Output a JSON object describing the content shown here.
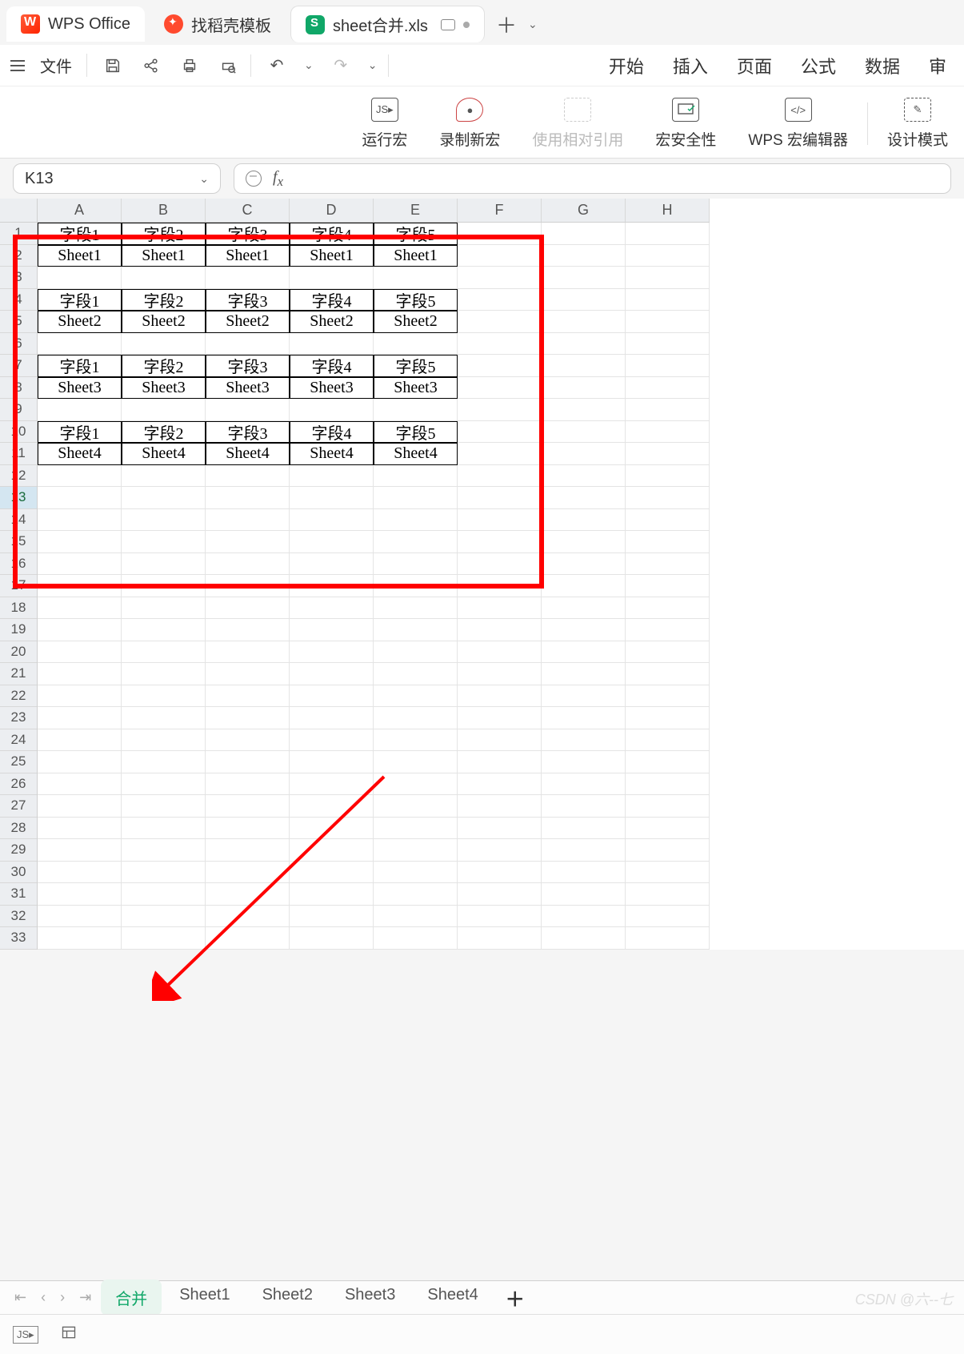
{
  "tabs": {
    "app": "WPS Office",
    "template": "找稻壳模板",
    "doc": "sheet合并.xls"
  },
  "file_label": "文件",
  "menu": {
    "start": "开始",
    "insert": "插入",
    "page": "页面",
    "formula": "公式",
    "data": "数据",
    "review": "审"
  },
  "ribbon": {
    "run_macro": "运行宏",
    "record_macro": "录制新宏",
    "relative_ref": "使用相对引用",
    "macro_security": "宏安全性",
    "wps_editor": "WPS 宏编辑器",
    "design_mode": "设计模式"
  },
  "name_box": "K13",
  "columns": [
    "A",
    "B",
    "C",
    "D",
    "E",
    "F",
    "G",
    "H"
  ],
  "sheet_data": {
    "1": [
      "字段1",
      "字段2",
      "字段3",
      "字段4",
      "字段5",
      "",
      "",
      ""
    ],
    "2": [
      "Sheet1",
      "Sheet1",
      "Sheet1",
      "Sheet1",
      "Sheet1",
      "",
      "",
      ""
    ],
    "3": [
      "",
      "",
      "",
      "",
      "",
      "",
      "",
      ""
    ],
    "4": [
      "字段1",
      "字段2",
      "字段3",
      "字段4",
      "字段5",
      "",
      "",
      ""
    ],
    "5": [
      "Sheet2",
      "Sheet2",
      "Sheet2",
      "Sheet2",
      "Sheet2",
      "",
      "",
      ""
    ],
    "6": [
      "",
      "",
      "",
      "",
      "",
      "",
      "",
      ""
    ],
    "7": [
      "字段1",
      "字段2",
      "字段3",
      "字段4",
      "字段5",
      "",
      "",
      ""
    ],
    "8": [
      "Sheet3",
      "Sheet3",
      "Sheet3",
      "Sheet3",
      "Sheet3",
      "",
      "",
      ""
    ],
    "9": [
      "",
      "",
      "",
      "",
      "",
      "",
      "",
      ""
    ],
    "10": [
      "字段1",
      "字段2",
      "字段3",
      "字段4",
      "字段5",
      "",
      "",
      ""
    ],
    "11": [
      "Sheet4",
      "Sheet4",
      "Sheet4",
      "Sheet4",
      "Sheet4",
      "",
      "",
      ""
    ]
  },
  "bordered_rows": [
    1,
    2,
    4,
    5,
    7,
    8,
    10,
    11
  ],
  "row_count": 33,
  "active_row": 13,
  "sheet_tabs": [
    "合并",
    "Sheet1",
    "Sheet2",
    "Sheet3",
    "Sheet4"
  ],
  "active_sheet": "合并",
  "watermark": "CSDN @六--七"
}
